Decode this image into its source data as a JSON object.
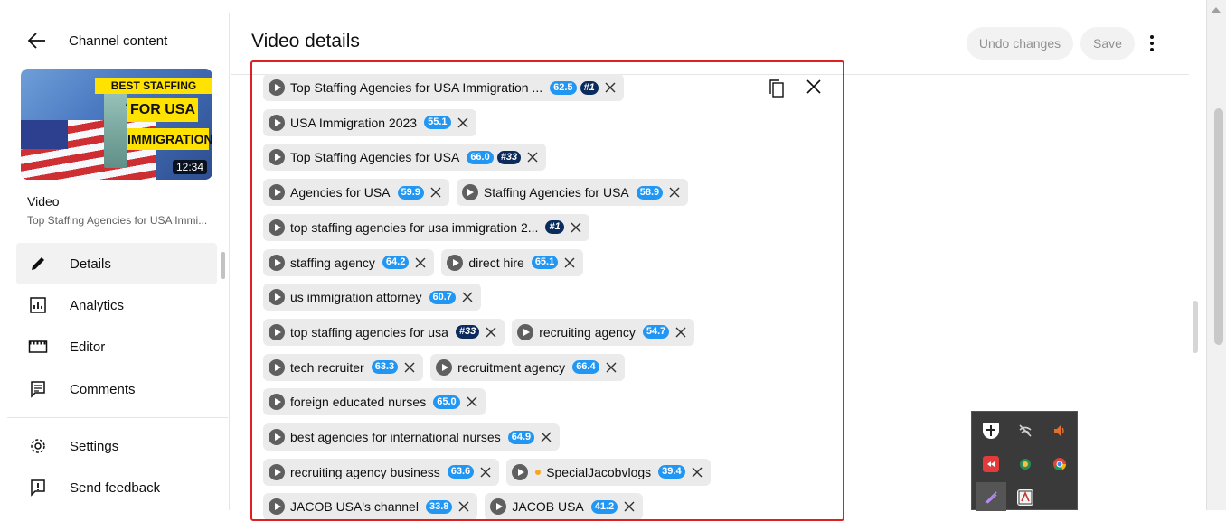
{
  "sidebar": {
    "title": "Channel content",
    "thumbnail": {
      "line1": "BEST STAFFING AGENCIES",
      "line2": "FOR USA",
      "line3": "IMMIGRATION",
      "duration": "12:34"
    },
    "video_label": "Video",
    "video_title": "Top Staffing Agencies for USA Immi...",
    "nav": [
      {
        "label": "Details",
        "icon": "pencil-icon",
        "active": true
      },
      {
        "label": "Analytics",
        "icon": "analytics-icon"
      },
      {
        "label": "Editor",
        "icon": "editor-icon"
      },
      {
        "label": "Comments",
        "icon": "comments-icon"
      }
    ],
    "bottom_nav": [
      {
        "label": "Settings",
        "icon": "gear-icon"
      },
      {
        "label": "Send feedback",
        "icon": "feedback-icon"
      }
    ]
  },
  "header": {
    "title": "Video details",
    "undo_label": "Undo changes",
    "save_label": "Save"
  },
  "tags": [
    [
      {
        "text": "Top Staffing Agencies for USA Immigration ...",
        "score": "62.5",
        "rank": "#1"
      }
    ],
    [
      {
        "text": "USA Immigration 2023",
        "score": "55.1"
      }
    ],
    [
      {
        "text": "Top Staffing Agencies for USA",
        "score": "66.0",
        "rank": "#33"
      }
    ],
    [
      {
        "text": "Agencies for USA",
        "score": "59.9"
      },
      {
        "text": "Staffing Agencies for USA",
        "score": "58.9"
      }
    ],
    [
      {
        "text": "top staffing agencies for usa immigration 2...",
        "rank": "#1"
      }
    ],
    [
      {
        "text": "staffing agency",
        "score": "64.2"
      },
      {
        "text": "direct hire",
        "score": "65.1"
      }
    ],
    [
      {
        "text": "us immigration attorney",
        "score": "60.7"
      }
    ],
    [
      {
        "text": "top staffing agencies for usa",
        "rank": "#33"
      },
      {
        "text": "recruiting agency",
        "score": "54.7"
      }
    ],
    [
      {
        "text": "tech recruiter",
        "score": "63.3"
      },
      {
        "text": "recruitment agency",
        "score": "66.4"
      }
    ],
    [
      {
        "text": "foreign educated nurses",
        "score": "65.0"
      }
    ],
    [
      {
        "text": "best agencies for international nurses",
        "score": "64.9"
      }
    ],
    [
      {
        "text": "recruiting agency business",
        "score": "63.6"
      },
      {
        "text": "SpecialJacobvlogs",
        "score": "39.4",
        "dot": true
      }
    ],
    [
      {
        "text": "JACOB USA's channel",
        "score": "33.8"
      },
      {
        "text": "JACOB USA",
        "score": "41.2"
      }
    ]
  ],
  "colors": {
    "score_badge": "#2196f3",
    "rank_badge": "#0b2b5c",
    "box_border": "#e02020"
  }
}
